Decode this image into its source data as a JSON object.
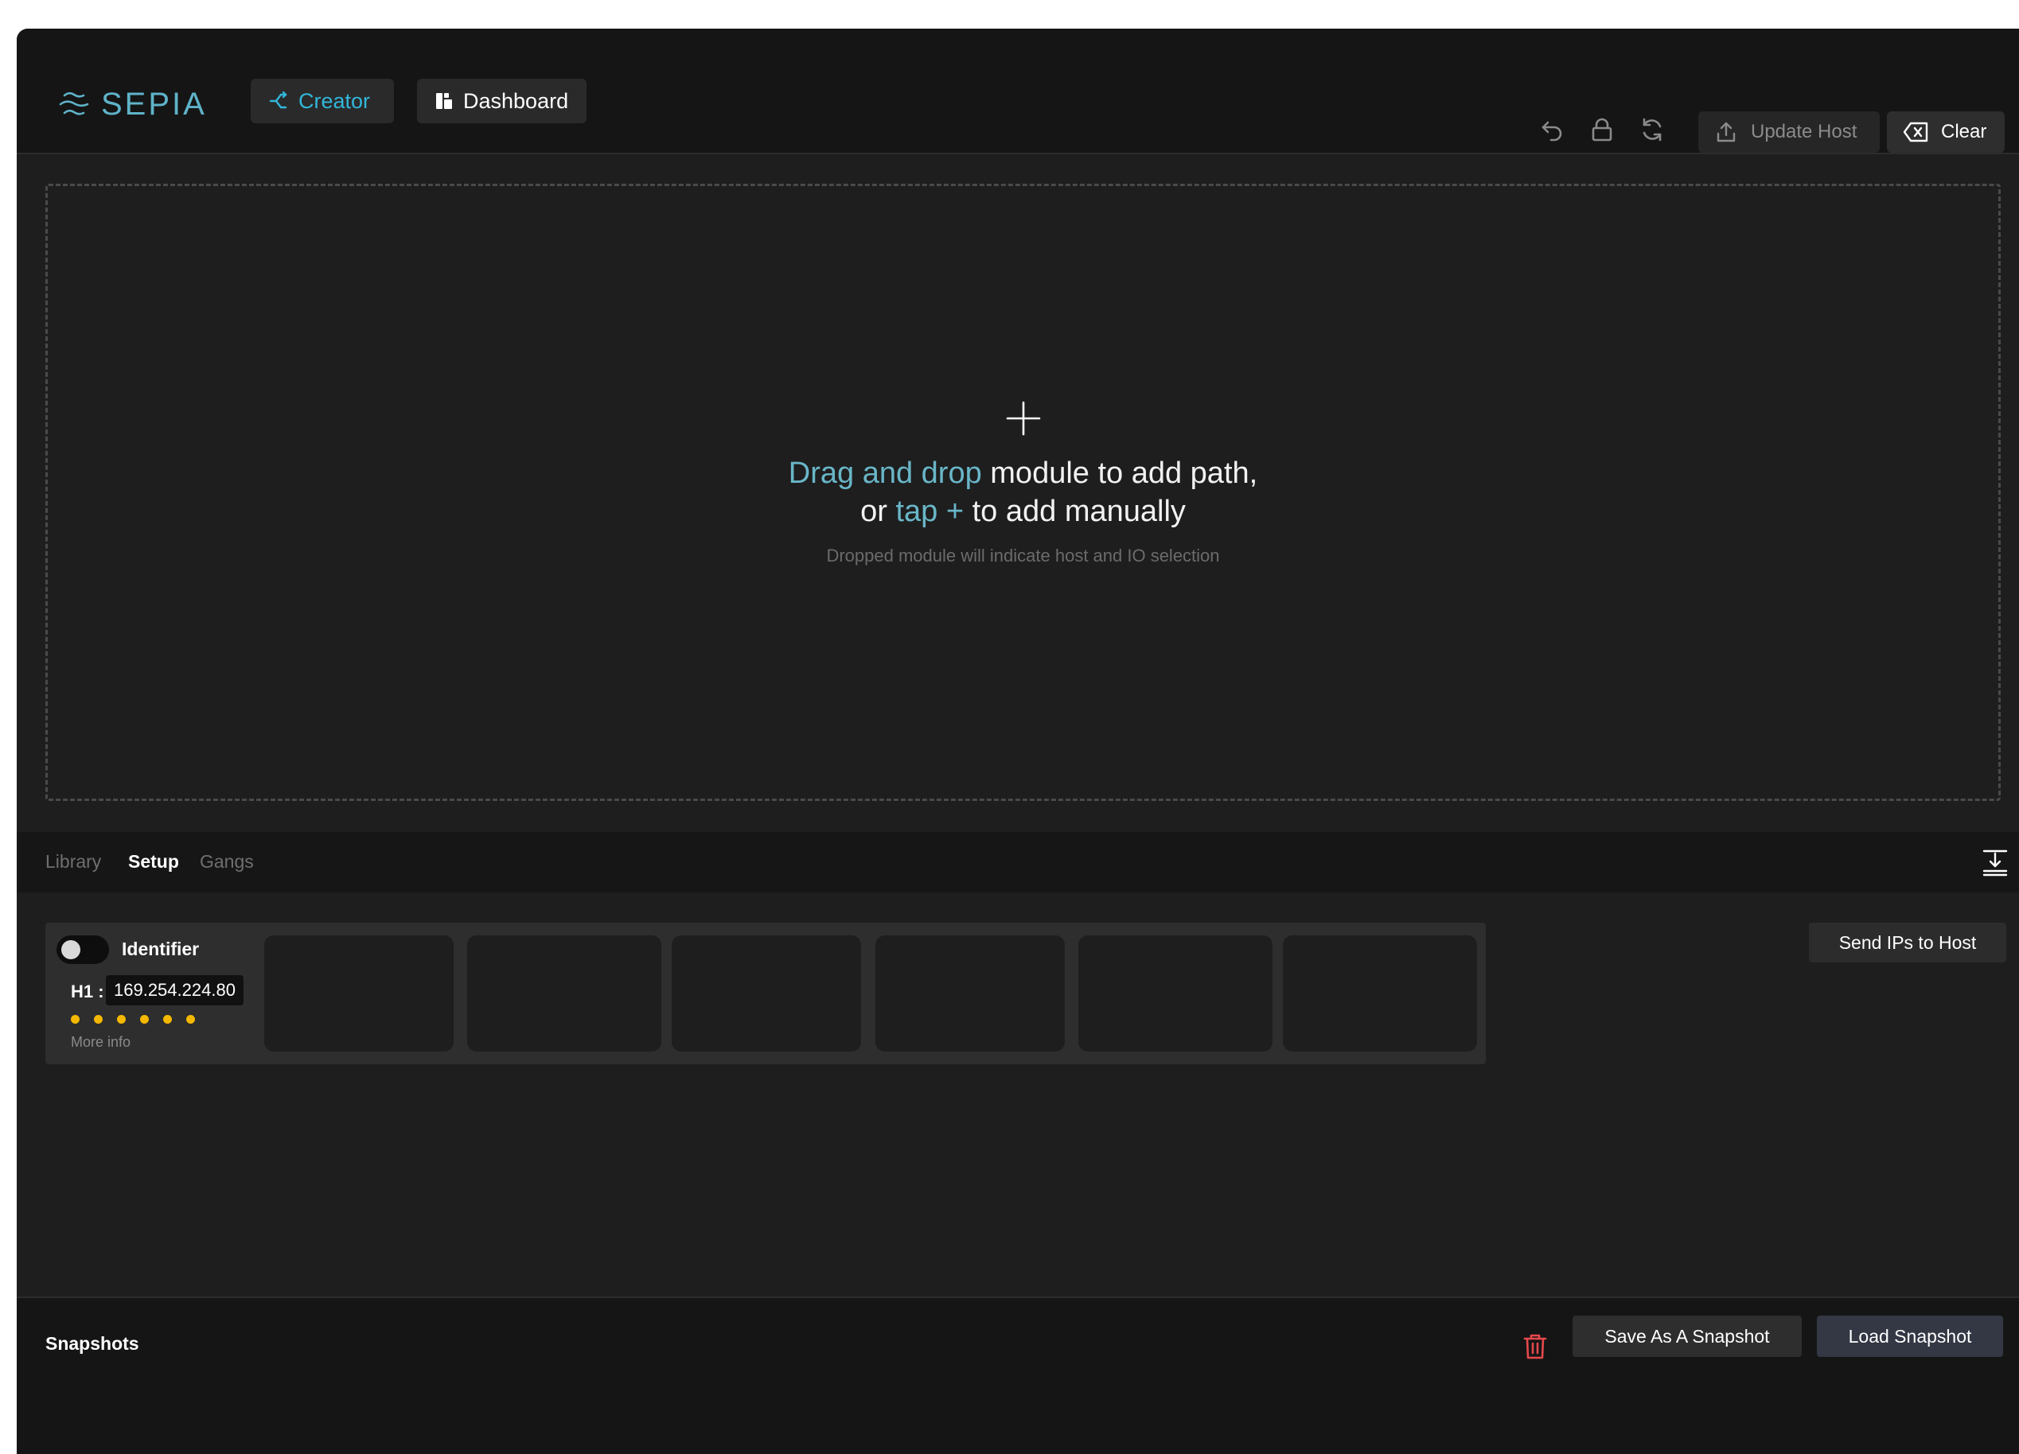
{
  "header": {
    "logo_text": "SEPIA",
    "nav": [
      {
        "label": "Creator",
        "icon": "share-icon"
      },
      {
        "label": "Dashboard",
        "icon": "dashboard-icon"
      }
    ],
    "actions": {
      "undo_icon": "undo-icon",
      "lock_icon": "lock-icon",
      "refresh_icon": "refresh-icon",
      "update_host_label": "Update Host",
      "clear_label": "Clear"
    }
  },
  "dropzone": {
    "line1_accent": "Drag and drop",
    "line1_rest": " module to add path,",
    "line2_prefix": "or ",
    "line2_accent": "tap +",
    "line2_rest": " to add manually",
    "subtitle": "Dropped module will indicate host and IO selection"
  },
  "tabs": [
    {
      "label": "Library",
      "active": false
    },
    {
      "label": "Setup",
      "active": true
    },
    {
      "label": "Gangs",
      "active": false
    }
  ],
  "setup": {
    "identifier_label": "Identifier",
    "host_label": "H1 :",
    "ip": "169.254.224.80",
    "status_dots": 6,
    "more_info_label": "More info",
    "send_ips_label": "Send IPs to Host"
  },
  "snapshots": {
    "title": "Snapshots",
    "save_label": "Save As A Snapshot",
    "load_label": "Load Snapshot"
  },
  "colors": {
    "accent": "#31b7d9",
    "text_accent": "#69b6c8",
    "status_dot": "#f5b800",
    "danger": "#e5484d"
  }
}
